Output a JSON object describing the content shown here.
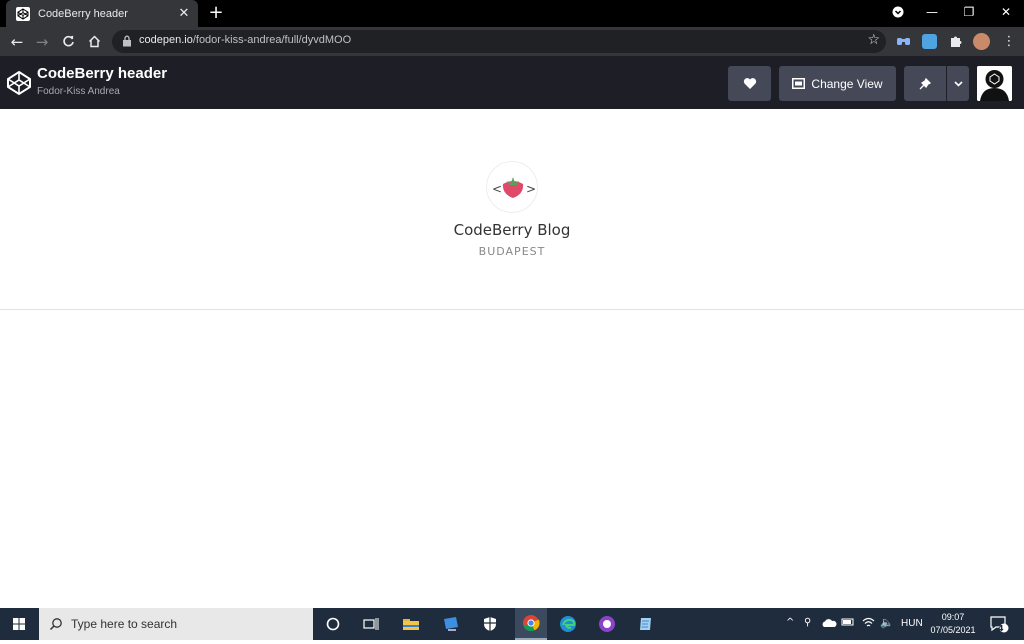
{
  "browser": {
    "tab_title": "CodeBerry header",
    "tab_close": "✕",
    "new_tab": "+",
    "url_domain": "codepen.io",
    "url_path": "/fodor-kiss-andrea/full/dyvdMOO",
    "window_controls": {
      "minimize": "—",
      "restore": "❐",
      "close": "✕"
    }
  },
  "codepen": {
    "title": "CodeBerry header",
    "author": "Fodor-Kiss Andrea",
    "change_view_label": "Change View"
  },
  "page": {
    "blog_name": "CodeBerry Blog",
    "city": "BUDAPEST"
  },
  "taskbar": {
    "search_placeholder": "Type here to search",
    "language": "HUN",
    "time": "09:07",
    "date": "07/05/2021",
    "notifications_count": "4"
  },
  "colors": {
    "browser_frame": "#000000",
    "toolbar": "#35363a",
    "codepen_header": "#1e1f26",
    "codepen_button": "#444857",
    "taskbar": "#1f2c3d",
    "berry": "#e04a6a"
  }
}
